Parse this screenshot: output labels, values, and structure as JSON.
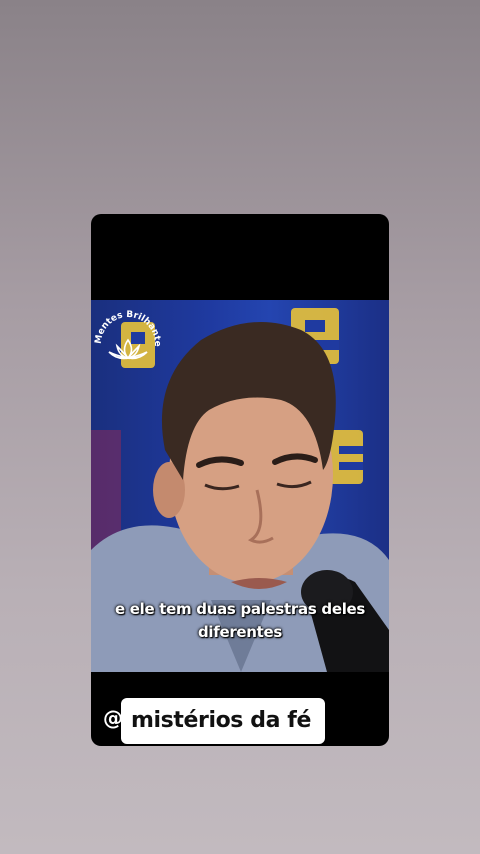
{
  "video": {
    "watermark_text": "Mentes Brilhantes",
    "watermark_icon": "lotus-icon",
    "subtitle_line1": "e ele tem duas palestras deles",
    "subtitle_line2": "diferentes"
  },
  "footer": {
    "at_symbol": "@",
    "handle": "mistérios da fé"
  },
  "colors": {
    "background": "#a69ca3",
    "card": "#000000",
    "studio_blue": "#1f3aa0",
    "studio_letters": "#e8c23a",
    "pill": "#ffffff"
  }
}
